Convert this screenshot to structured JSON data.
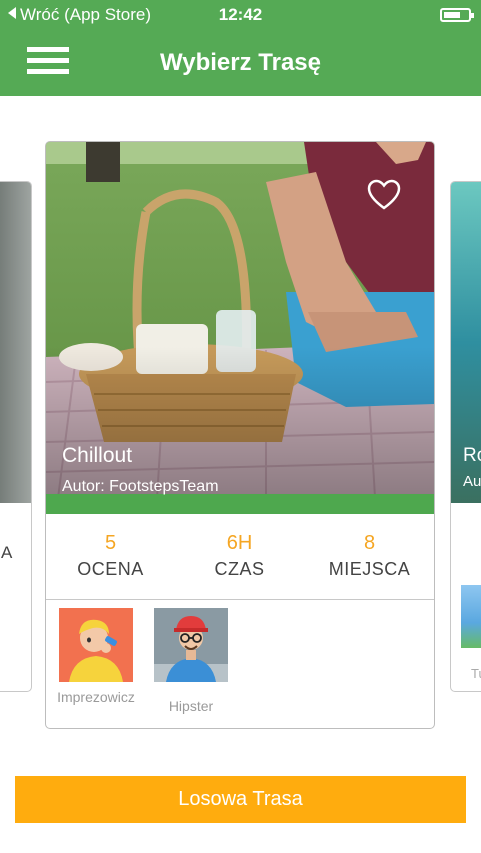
{
  "status_bar": {
    "back_label": "Wróć (App Store)",
    "time": "12:42"
  },
  "header": {
    "title": "Wybierz Trasę"
  },
  "side_left": {
    "stat_fragment": "A"
  },
  "side_right": {
    "name_fragment": "Ro",
    "author_fragment": "Au",
    "label_fragment": "Tu"
  },
  "route": {
    "name": "Chillout",
    "author": "Autor:  FootstepsTeam",
    "stats": [
      {
        "value": "5",
        "label": "OCENA"
      },
      {
        "value": "6H",
        "label": "CZAS"
      },
      {
        "value": "8",
        "label": "MIEJSCA"
      }
    ],
    "categories": [
      {
        "label": "Imprezowicz",
        "icon": "partygoer-avatar-icon"
      },
      {
        "label": "Hipster",
        "icon": "hipster-avatar-icon"
      }
    ]
  },
  "random_button_label": "Losowa Trasa",
  "colors": {
    "header_green": "#55aa55",
    "accent_orange": "#f5a623",
    "button_orange": "#ffac0e"
  }
}
